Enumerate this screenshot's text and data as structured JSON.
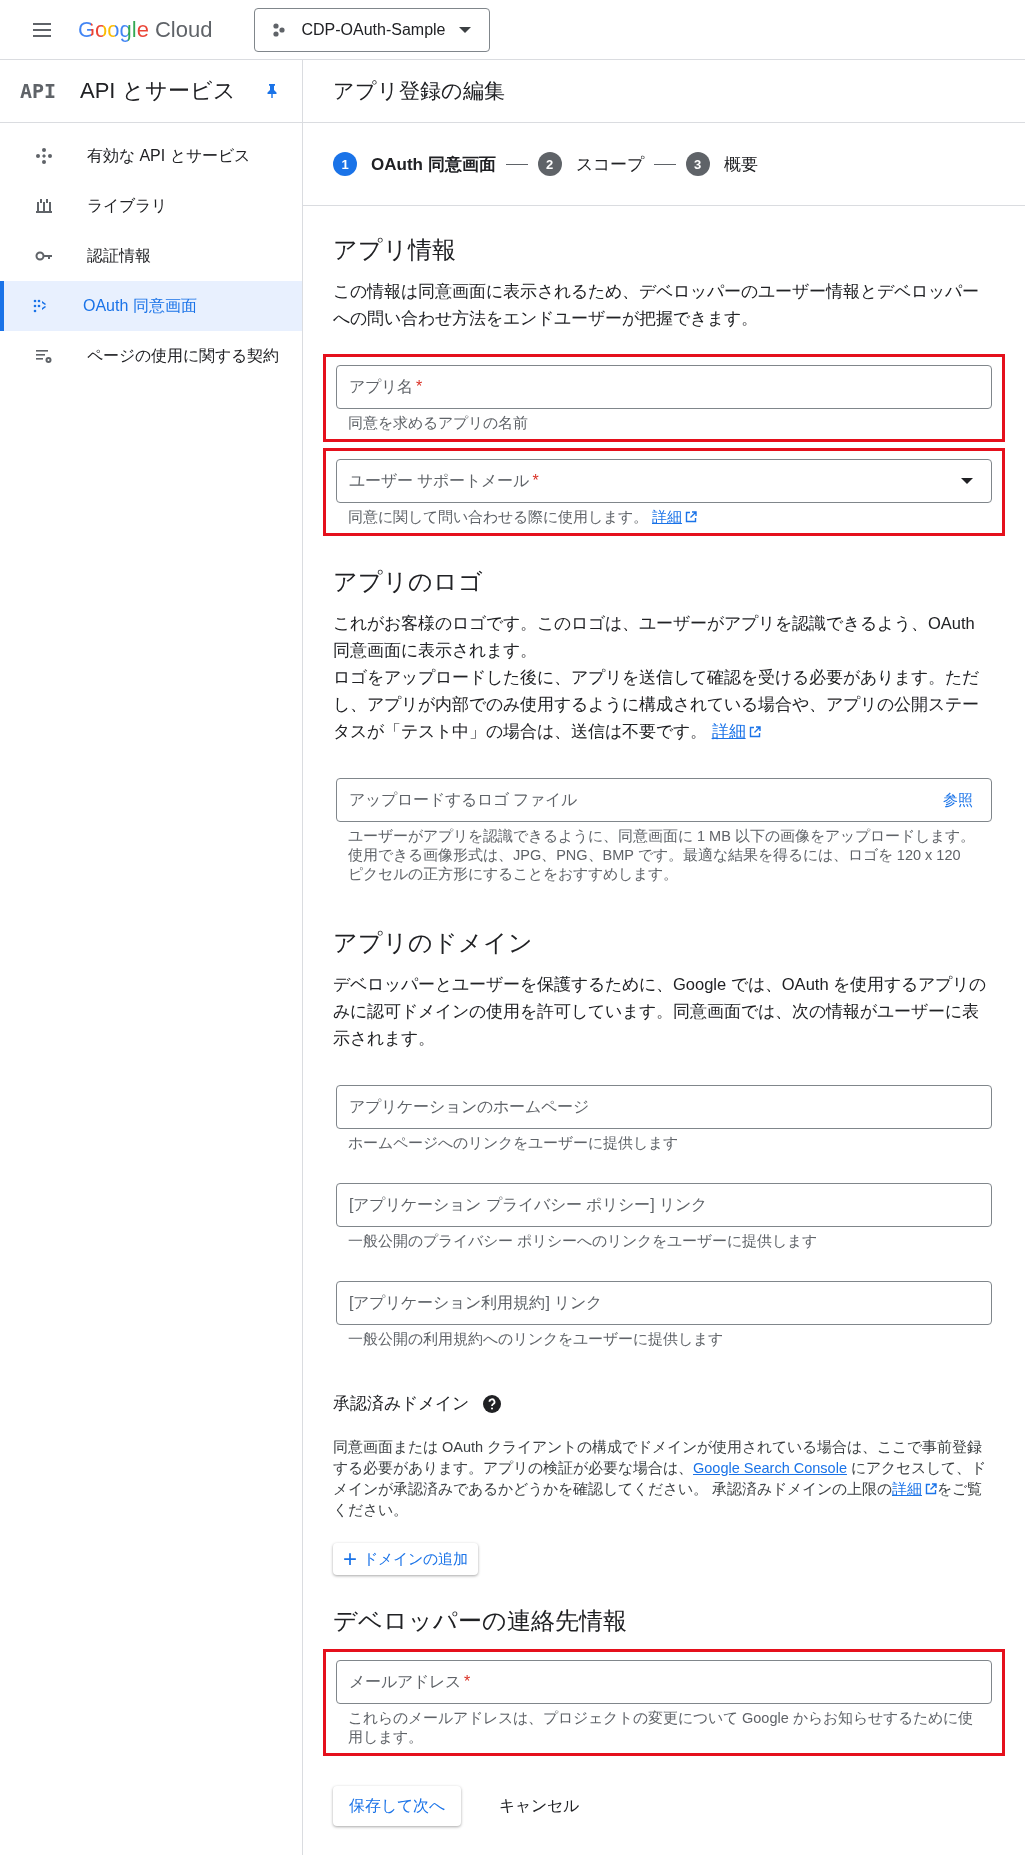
{
  "topbar": {
    "logo_word": "Google",
    "logo_product": "Cloud",
    "project": "CDP-OAuth-Sample"
  },
  "sidebar": {
    "badge": "API",
    "title": "API とサービス",
    "pinned": true,
    "items": [
      {
        "kind": "diamond",
        "label": "有効な API とサービス",
        "selected": false
      },
      {
        "kind": "library",
        "label": "ライブラリ",
        "selected": false
      },
      {
        "kind": "key",
        "label": "認証情報",
        "selected": false
      },
      {
        "kind": "consent",
        "label": "OAuth 同意画面",
        "selected": true
      },
      {
        "kind": "settings",
        "label": "ページの使用に関する契約",
        "selected": false
      }
    ]
  },
  "page_title": "アプリ登録の編集",
  "steps": [
    {
      "number": "1",
      "label": "OAuth 同意画面",
      "selected": true
    },
    {
      "number": "2",
      "label": "スコープ",
      "selected": false
    },
    {
      "number": "3",
      "label": "概要",
      "selected": false
    }
  ],
  "sections": [
    {
      "heading": "アプリ情報",
      "paragraphs": [
        [
          {
            "text": "この情報は同意画面に表示されるため、デベロッパーのユーザー情報とデベロッパーへの問い合わせ方法をエンドユーザーが把握できます。"
          }
        ]
      ],
      "fields": [
        {
          "kind": "text",
          "placeholder": "アプリ名",
          "required": "*",
          "hint": [
            {
              "text": "同意を求めるアプリの名前"
            }
          ],
          "highlighted": true
        },
        {
          "kind": "select",
          "placeholder": "ユーザー サポートメール",
          "required": "*",
          "hint": [
            {
              "text": "同意に関して問い合わせる際に使用します。 "
            },
            {
              "link": "詳細",
              "external": true
            }
          ],
          "highlighted": true
        }
      ]
    },
    {
      "heading": "アプリのロゴ",
      "paragraphs": [
        [
          {
            "text": "これがお客様のロゴです。このロゴは、ユーザーがアプリを認識できるよう、OAuth 同意画面に表示されます。"
          }
        ],
        [
          {
            "text": "ロゴをアップロードした後に、アプリを送信して確認を受ける必要があります。ただし、アプリが内部でのみ使用するように構成されている場合や、アプリの公開ステータスが「テスト中」の場合は、送信は不要です。 "
          },
          {
            "link": "詳細",
            "external": true
          }
        ]
      ],
      "fields": [
        {
          "kind": "file",
          "placeholder": "アップロードするロゴ ファイル",
          "action": "参照",
          "hint": [
            {
              "text": "ユーザーがアプリを認識できるように、同意画面に 1 MB 以下の画像をアップロードします。使用できる画像形式は、JPG、PNG、BMP です。最適な結果を得るには、ロゴを 120 x 120 ピクセルの正方形にすることをおすすめします。"
            }
          ],
          "highlighted": false
        }
      ]
    },
    {
      "heading": "アプリのドメイン",
      "paragraphs": [
        [
          {
            "text": "デベロッパーとユーザーを保護するために、Google では、OAuth を使用するアプリのみに認可ドメインの使用を許可しています。同意画面では、次の情報がユーザーに表示されます。"
          }
        ]
      ],
      "fields": [
        {
          "kind": "text",
          "placeholder": "アプリケーションのホームページ",
          "hint": [
            {
              "text": "ホームページへのリンクをユーザーに提供します"
            }
          ],
          "highlighted": false
        },
        {
          "kind": "text",
          "placeholder": "[アプリケーション プライバシー ポリシー] リンク",
          "hint": [
            {
              "text": "一般公開のプライバシー ポリシーへのリンクをユーザーに提供します"
            }
          ],
          "highlighted": false
        },
        {
          "kind": "text",
          "placeholder": "[アプリケーション利用規約] リンク",
          "hint": [
            {
              "text": "一般公開の利用規約へのリンクをユーザーに提供します"
            }
          ],
          "highlighted": false
        }
      ]
    },
    {
      "subheading": "承認済みドメイン",
      "help": true,
      "paragraphs": [
        [
          {
            "text": "同意画面または OAuth クライアントの構成でドメインが使用されている場合は、ここで事前登録する必要があります。アプリの検証が必要な場合は、"
          },
          {
            "link": "Google Search Console",
            "external": false
          },
          {
            "text": " にアクセスして、ドメインが承認済みであるかどうかを確認してください。 承認済みドメインの上限の"
          },
          {
            "link": "詳細",
            "external": true
          },
          {
            "text": "をご覧ください。"
          }
        ]
      ],
      "add_button": {
        "icon": "+",
        "label": "ドメインの追加"
      }
    },
    {
      "heading": "デベロッパーの連絡先情報",
      "fields": [
        {
          "kind": "text",
          "placeholder": "メールアドレス",
          "required": "*",
          "hint": [
            {
              "text": "これらのメールアドレスは、プロジェクトの変更について Google からお知らせするために使用します。"
            }
          ],
          "highlighted": true
        }
      ]
    }
  ],
  "actions": {
    "primary": "保存して次へ",
    "secondary": "キャンセル"
  }
}
